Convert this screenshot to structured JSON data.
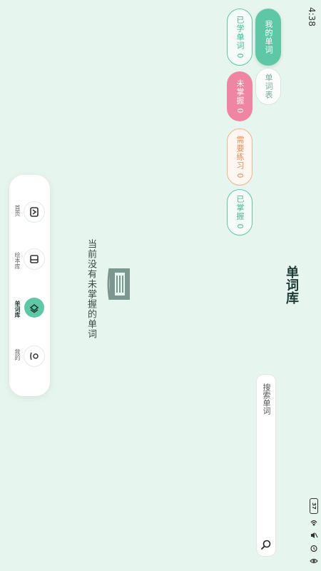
{
  "status_bar": {
    "time": "4:38",
    "battery": "37"
  },
  "header": {
    "title": "单词库"
  },
  "search": {
    "placeholder": "搜索单词"
  },
  "filters": {
    "my_words": "我的单词",
    "word_list": "单词表",
    "learned": "已学单词 0",
    "unmastered": "未掌握 0",
    "needs_practice": "需要练习 0",
    "mastered": "已掌握 0"
  },
  "empty_state": {
    "message": "当前没有未掌握的单词"
  },
  "bottom_nav": {
    "items": [
      {
        "label": "首页",
        "icon": "home-icon"
      },
      {
        "label": "绘本库",
        "icon": "book-icon"
      },
      {
        "label": "单词库",
        "icon": "layers-icon",
        "active": true
      },
      {
        "label": "我的",
        "icon": "user-icon"
      }
    ]
  },
  "colors": {
    "accent": "#5ec8a6",
    "unmastered": "#ef85a2",
    "practice": "#e98c4f",
    "background": "#e6f6ef"
  }
}
